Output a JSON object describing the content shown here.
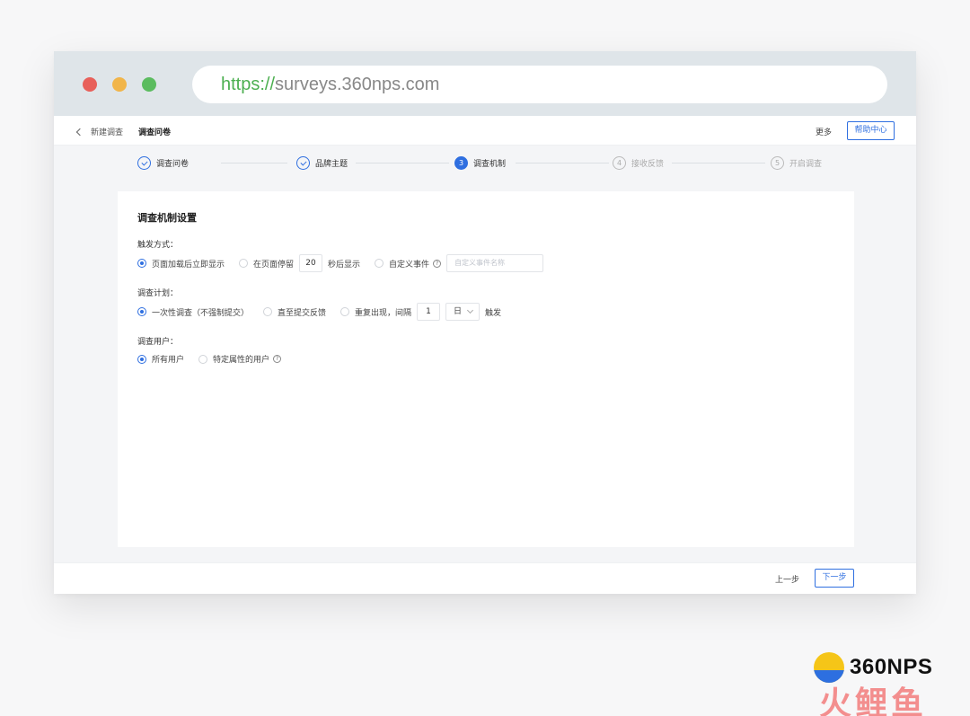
{
  "browser": {
    "url_protocol": "https://",
    "url_rest": "surveys.360nps.com"
  },
  "topnav": {
    "back_label": "新建调查",
    "current": "调查问卷",
    "more": "更多",
    "help": "帮助中心"
  },
  "steps": [
    {
      "index": "",
      "label": "调查问卷",
      "state": "done"
    },
    {
      "index": "",
      "label": "品牌主题",
      "state": "done"
    },
    {
      "index": "3",
      "label": "调查机制",
      "state": "active"
    },
    {
      "index": "4",
      "label": "接收反馈",
      "state": "todo"
    },
    {
      "index": "5",
      "label": "开启调查",
      "state": "todo"
    }
  ],
  "card": {
    "title": "调查机制设置",
    "trigger": {
      "label": "触发方式：",
      "opt1": "页面加载后立即显示",
      "opt2_pre": "在页面停留",
      "opt2_value": "20",
      "opt2_post": "秒后显示",
      "opt3": "自定义事件",
      "event_placeholder": "自定义事件名称"
    },
    "plan": {
      "label": "调查计划：",
      "opt1": "一次性调查（不强制提交）",
      "opt2": "直至提交反馈",
      "opt3_pre": "重复出现，间隔",
      "interval_value": "1",
      "unit": "日",
      "opt3_post": "触发"
    },
    "users": {
      "label": "调查用户：",
      "opt1": "所有用户",
      "opt2": "特定属性的用户"
    }
  },
  "footer": {
    "prev": "上一步",
    "next": "下一步"
  },
  "brand": {
    "name": "360NPS",
    "watermark": "火鲤鱼"
  }
}
